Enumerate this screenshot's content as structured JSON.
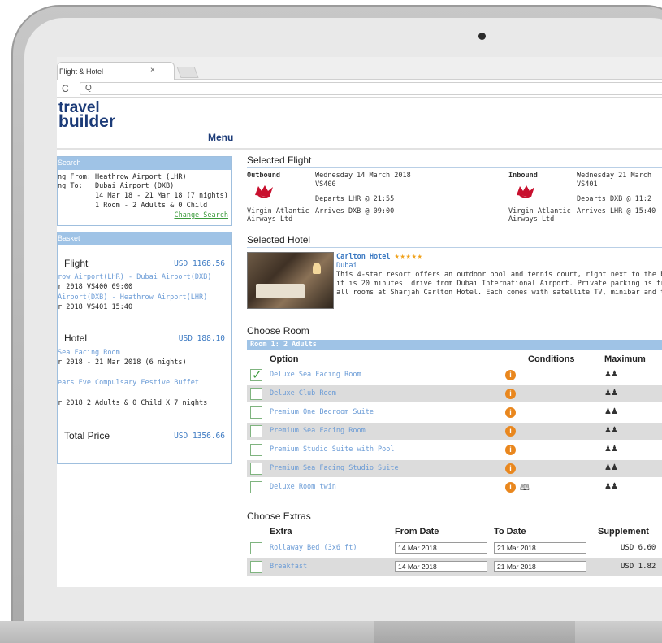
{
  "browser": {
    "tab_title": "Flight & Hotel",
    "tab_close": "×",
    "reload_glyph": "C",
    "search_glyph": "Q"
  },
  "logo": {
    "line1": "travel",
    "line2": "builder"
  },
  "nav": {
    "menu_label": "Menu"
  },
  "search_panel": {
    "header": "Search",
    "lines": [
      "ng From: Heathrow Airport (LHR)",
      "ng To:   Dubai Airport (DXB)",
      "         14 Mar 18 - 21 Mar 18 (7 nights)",
      "         1 Room - 2 Adults & 0 Child"
    ],
    "change_link": "Change Search"
  },
  "basket": {
    "header": "Basket",
    "flight": {
      "title": "Flight",
      "price": "USD 1168.56",
      "out_link": "row Airport(LHR) - Dubai Airport(DXB)",
      "out_detail": "r 2018 VS400 09:00",
      "ret_link": "Airport(DXB) - Heathrow Airport(LHR)",
      "ret_detail": "r 2018 VS401 15:40"
    },
    "hotel": {
      "title": "Hotel",
      "price": "USD 188.10",
      "room_link": "Sea Facing Room",
      "room_dates": "r 2018 - 21 Mar 2018 (6 nights)",
      "extra_link": "ears Eve Compulsary Festive Buffet",
      "extra_detail": "r 2018 2 Adults & 0 Child X 7 nights"
    },
    "total_label": "Total Price",
    "total_price": "USD 1356.66"
  },
  "selected_flight": {
    "title": "Selected Flight",
    "outbound": {
      "label": "Outbound",
      "date": "Wednesday 14 March 2018",
      "flight_no": "VS400",
      "departs": "Departs LHR @ 21:55",
      "arrives": "Arrives DXB @ 09:00",
      "airline_line1": "Virgin Atlantic",
      "airline_line2": "Airways Ltd"
    },
    "inbound": {
      "label": "Inbound",
      "date": "Wednesday 21 March",
      "flight_no": "VS401",
      "departs": "Departs DXB @ 11:2",
      "arrives": "Arrives LHR @ 15:40",
      "airline_line1": "Virgin Atlantic",
      "airline_line2": "Airways Ltd"
    }
  },
  "selected_hotel": {
    "title": "Selected Hotel",
    "name": "Carlton Hotel",
    "stars": "★★★★★",
    "city": "Dubai",
    "desc_line1": "This 4-star resort offers an outdoor pool and tennis court, right next to the bea",
    "desc_line2": "it is 20 minutes' drive from Dubai International Airport. Private parking is free.",
    "desc_line3": "all rooms at Sharjah Carlton Hotel. Each comes with satellite TV, minibar and t"
  },
  "choose_room": {
    "title": "Choose Room",
    "subheader": "Room 1: 2 Adults",
    "col_option": "Option",
    "col_conditions": "Conditions",
    "col_maximum": "Maximum",
    "info_glyph": "i",
    "people_glyph": "♟♟",
    "book_glyph": "🕮",
    "rows": [
      {
        "name": "Deluxe Sea Facing Room",
        "checked": true
      },
      {
        "name": "Deluxe Club Room",
        "checked": false
      },
      {
        "name": "Premium One Bedroom Suite",
        "checked": false
      },
      {
        "name": "Premium Sea Facing Room",
        "checked": false
      },
      {
        "name": "Premium Studio Suite with Pool",
        "checked": false
      },
      {
        "name": "Premium Sea Facing Studio Suite",
        "checked": false
      },
      {
        "name": "Deluxe Room twin",
        "checked": false
      }
    ],
    "tick_glyph": "✓"
  },
  "choose_extras": {
    "title": "Choose Extras",
    "col_extra": "Extra",
    "col_from": "From Date",
    "col_to": "To Date",
    "col_supplement": "Supplement",
    "rows": [
      {
        "name": "Rollaway Bed (3x6 ft)",
        "from": "14 Mar 2018",
        "to": "21 Mar 2018",
        "supplement": "USD 6.60"
      },
      {
        "name": "Breakfast",
        "from": "14 Mar 2018",
        "to": "21 Mar 2018",
        "supplement": "USD 1.82"
      }
    ]
  },
  "colors": {
    "brand": "#1c3b78",
    "panel_header": "#9fc3e6",
    "link": "#6a9bd6",
    "price": "#3b79c2",
    "accent_green": "#3a9a3a",
    "info_orange": "#e9871e",
    "star": "#f0a11a",
    "virgin_red": "#c8102e"
  }
}
